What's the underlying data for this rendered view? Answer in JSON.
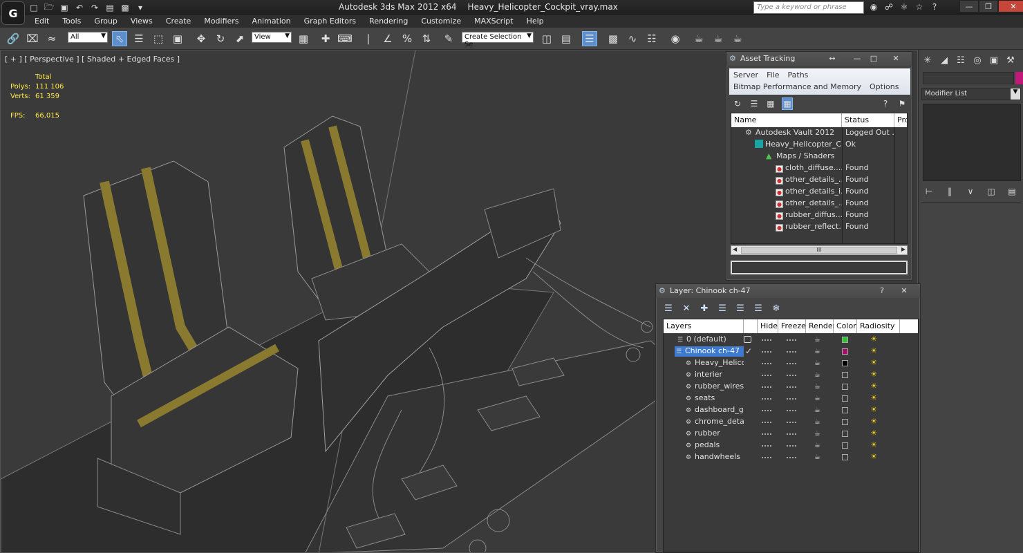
{
  "title": {
    "app": "Autodesk 3ds Max  2012 x64",
    "file": "Heavy_Helicopter_Cockpit_vray.max"
  },
  "search": {
    "placeholder": "Type a keyword or phrase"
  },
  "menu": [
    "Edit",
    "Tools",
    "Group",
    "Views",
    "Create",
    "Modifiers",
    "Animation",
    "Graph Editors",
    "Rendering",
    "Customize",
    "MAXScript",
    "Help"
  ],
  "toolbar": {
    "filter": "All",
    "coord": "View",
    "selection_set": "Create Selection Se"
  },
  "viewport": {
    "label": "[ + ] [ Perspective ] [ Shaded + Edged Faces ]",
    "stats": {
      "header": "Total",
      "polys_label": "Polys:",
      "polys": "111 106",
      "verts_label": "Verts:",
      "verts": "61 359",
      "fps_label": "FPS:",
      "fps": "66,015"
    }
  },
  "command_panel": {
    "modifier_list": "Modifier List",
    "object_color": "#c2187a"
  },
  "asset_tracking": {
    "title": "Asset Tracking",
    "menu_row1": [
      "Server",
      "File",
      "Paths"
    ],
    "menu_row2": [
      "Bitmap Performance and Memory",
      "Options"
    ],
    "columns": [
      "Name",
      "Status",
      "Pro"
    ],
    "rows": [
      {
        "name": "Autodesk Vault 2012",
        "status": "Logged Out ...",
        "icon": "vault"
      },
      {
        "name": "Heavy_Helicopter_C...",
        "status": "Ok",
        "icon": "max"
      },
      {
        "name": "Maps / Shaders",
        "status": "",
        "icon": "map"
      },
      {
        "name": "cloth_diffuse....",
        "status": "Found",
        "icon": "file"
      },
      {
        "name": "other_details_...",
        "status": "Found",
        "icon": "file"
      },
      {
        "name": "other_details_i...",
        "status": "Found",
        "icon": "file"
      },
      {
        "name": "other_details_...",
        "status": "Found",
        "icon": "file"
      },
      {
        "name": "rubber_diffus....",
        "status": "Found",
        "icon": "file"
      },
      {
        "name": "rubber_reflect....",
        "status": "Found",
        "icon": "file"
      }
    ],
    "scroll_grip": "III"
  },
  "layers": {
    "title": "Layer: Chinook ch-47",
    "columns": [
      "Layers",
      "Hide",
      "Freeze",
      "Render",
      "Color",
      "Radiosity"
    ],
    "rows": [
      {
        "name": "0 (default)",
        "color": "#30c030"
      },
      {
        "name": "Chinook ch-47",
        "color": "#a0106a"
      },
      {
        "name": "Heavy_Helicopte",
        "color": "#000000"
      },
      {
        "name": "interier",
        "color": ""
      },
      {
        "name": "rubber_wires",
        "color": ""
      },
      {
        "name": "seats",
        "color": ""
      },
      {
        "name": "dashboard_glass",
        "color": ""
      },
      {
        "name": "chrome_details",
        "color": ""
      },
      {
        "name": "rubber",
        "color": ""
      },
      {
        "name": "pedals",
        "color": ""
      },
      {
        "name": "handwheels",
        "color": ""
      }
    ]
  }
}
